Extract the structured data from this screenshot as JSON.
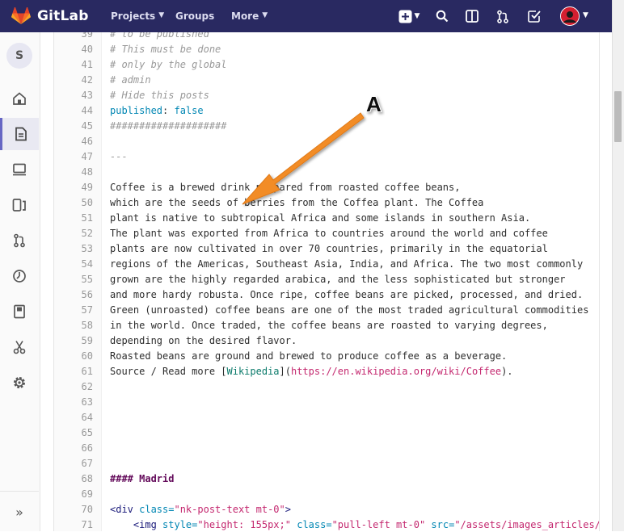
{
  "header": {
    "brand": "GitLab",
    "nav": [
      {
        "label": "Projects",
        "has_dropdown": true
      },
      {
        "label": "Groups",
        "has_dropdown": false
      },
      {
        "label": "More",
        "has_dropdown": true
      }
    ],
    "icons": [
      "plus-icon",
      "search-icon",
      "issues-icon",
      "merge-requests-icon",
      "todos-icon",
      "user-avatar"
    ]
  },
  "sidebar": {
    "project_avatar_letter": "S",
    "items": [
      "home-icon",
      "repository-icon",
      "issues-icon",
      "merge-requests-icon",
      "ci-cd-icon",
      "operations-icon",
      "wiki-icon",
      "snippets-icon",
      "settings-icon"
    ],
    "active_index": 1,
    "collapse_label": "»"
  },
  "editor": {
    "lines": [
      {
        "n": "39",
        "text": "# to be published",
        "kind": "comment"
      },
      {
        "n": "40",
        "text": "# This must be done",
        "kind": "comment"
      },
      {
        "n": "41",
        "text": "# only by the global",
        "kind": "comment"
      },
      {
        "n": "42",
        "text": "# admin",
        "kind": "comment"
      },
      {
        "n": "43",
        "text": "# Hide this posts",
        "kind": "comment"
      },
      {
        "n": "44",
        "text": "published: false",
        "kind": "keyval",
        "key": "published",
        "value": "false"
      },
      {
        "n": "45",
        "text": "####################",
        "kind": "comment"
      },
      {
        "n": "46",
        "text": "",
        "kind": "plain"
      },
      {
        "n": "47",
        "text": "---",
        "kind": "comment"
      },
      {
        "n": "48",
        "text": "",
        "kind": "plain"
      },
      {
        "n": "49",
        "text": "Coffee is a brewed drink prepared from roasted coffee beans,",
        "kind": "plain"
      },
      {
        "n": "50",
        "text": "which are the seeds of berries from the Coffea plant. The Coffea",
        "kind": "plain"
      },
      {
        "n": "51",
        "text": "plant is native to subtropical Africa and some islands in southern Asia.",
        "kind": "plain"
      },
      {
        "n": "52",
        "text": "The plant was exported from Africa to countries around the world and coffee",
        "kind": "plain"
      },
      {
        "n": "53",
        "text": "plants are now cultivated in over 70 countries, primarily in the equatorial",
        "kind": "plain"
      },
      {
        "n": "54",
        "text": "regions of the Americas, Southeast Asia, India, and Africa. The two most commonly",
        "kind": "plain"
      },
      {
        "n": "55",
        "text": "grown are the highly regarded arabica, and the less sophisticated but stronger",
        "kind": "plain"
      },
      {
        "n": "56",
        "text": "and more hardy robusta. Once ripe, coffee beans are picked, processed, and dried.",
        "kind": "plain"
      },
      {
        "n": "57",
        "text": "Green (unroasted) coffee beans are one of the most traded agricultural commodities",
        "kind": "plain"
      },
      {
        "n": "58",
        "text": "in the world. Once traded, the coffee beans are roasted to varying degrees,",
        "kind": "plain"
      },
      {
        "n": "59",
        "text": "depending on the desired flavor.",
        "kind": "plain"
      },
      {
        "n": "60",
        "text": "Roasted beans are ground and brewed to produce coffee as a beverage.",
        "kind": "plain"
      },
      {
        "n": "61",
        "text": "Source / Read more [Wikipedia](https://en.wikipedia.org/wiki/Coffee).",
        "kind": "link",
        "prefix": "Source / Read more [",
        "link_text": "Wikipedia",
        "mid": "](",
        "url": "https://en.wikipedia.org/wiki/Coffee",
        "suffix": ")."
      },
      {
        "n": "62",
        "text": "",
        "kind": "plain"
      },
      {
        "n": "63",
        "text": "",
        "kind": "plain"
      },
      {
        "n": "64",
        "text": "",
        "kind": "plain"
      },
      {
        "n": "65",
        "text": "",
        "kind": "plain"
      },
      {
        "n": "66",
        "text": "",
        "kind": "plain"
      },
      {
        "n": "67",
        "text": "",
        "kind": "plain"
      },
      {
        "n": "68",
        "text": "#### Madrid",
        "kind": "heading"
      },
      {
        "n": "69",
        "text": "",
        "kind": "plain"
      },
      {
        "n": "70",
        "text": "<div class=\"nk-post-text mt-0\">",
        "kind": "html",
        "tokens": [
          [
            "tag",
            "<div "
          ],
          [
            "attr",
            "class="
          ],
          [
            "str",
            "\"nk-post-text mt-0\""
          ],
          [
            "tag",
            ">"
          ]
        ]
      },
      {
        "n": "71",
        "text": "    <img style=\"height: 155px;\" class=\"pull-left mt-0\" src=\"/assets/images_articles/{{",
        "kind": "html",
        "tokens": [
          [
            "plain",
            "    "
          ],
          [
            "tag",
            "<img "
          ],
          [
            "attr",
            "style="
          ],
          [
            "str",
            "\"height: 155px;\""
          ],
          [
            "plain",
            " "
          ],
          [
            "attr",
            "class="
          ],
          [
            "str",
            "\"pull-left mt-0\""
          ],
          [
            "plain",
            " "
          ],
          [
            "attr",
            "src="
          ],
          [
            "str",
            "\"/assets/images_articles/{{"
          ]
        ]
      }
    ]
  },
  "annotation": {
    "label": "A",
    "color": "#f28c28"
  }
}
